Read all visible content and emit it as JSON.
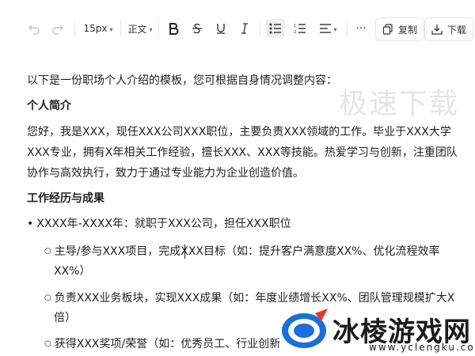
{
  "toolbar": {
    "font_size": "15px",
    "paragraph_style": "正文",
    "copy_label": "复制",
    "download_label": "下载"
  },
  "doc": {
    "intro": "以下是一份职场个人介绍的模板，您可根据自身情况调整内容：",
    "h1": "个人简介",
    "p1": "您好，我是XXX，现任XXX公司XXX职位，主要负责XXX领域的工作。毕业于XXX大学",
    "p2": "XXX专业，拥有X年相关工作经验，擅长XXX、XXX等技能。热爱学习与创新，注重团队",
    "p3": "协作与高效执行，致力于通过专业能力为企业创造价值。",
    "h2": "工作经历与成果",
    "bullet1": "XXXX年-XXXX年：就职于XXX公司，担任XXX职位",
    "sub1a": "主导/参与XXX项目，完成XXX目标（如：提升客户满意度XX%、优化流程效率",
    "sub1b": "XX%）",
    "sub2a": "负责XXX业务板块，实现XXX成果（如：年度业绩增长XX%、团队管理规模扩大X",
    "sub2b": "倍）",
    "sub3a": "获得XXX奖项/荣誉（如：优秀员工、行业创新"
  },
  "watermark": {
    "top": "极速下载",
    "brand": "冰棱游戏网",
    "url": "www.yclengku.com"
  },
  "colors": {
    "logo_blue": "#1a6fd8",
    "logo_red": "#e03b2b"
  }
}
